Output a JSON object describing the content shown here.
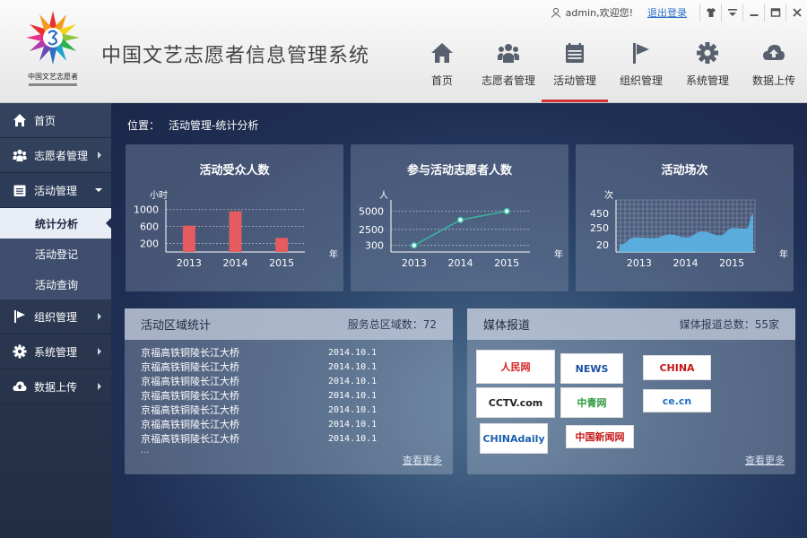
{
  "header": {
    "app_title": "中国文艺志愿者信息管理系统",
    "logo_text": "中国文艺志愿者",
    "user_welcome": "admin,欢迎您!",
    "logout": "退出登录"
  },
  "nav": [
    {
      "label": "首页",
      "icon": "home-icon"
    },
    {
      "label": "志愿者管理",
      "icon": "users-icon"
    },
    {
      "label": "活动管理",
      "icon": "calendar-icon",
      "active": true
    },
    {
      "label": "组织管理",
      "icon": "flag-icon"
    },
    {
      "label": "系统管理",
      "icon": "gear-icon"
    },
    {
      "label": "数据上传",
      "icon": "cloud-upload-icon"
    }
  ],
  "sidebar": {
    "items": [
      {
        "label": "首页"
      },
      {
        "label": "志愿者管理"
      },
      {
        "label": "活动管理"
      },
      {
        "label": "组织管理"
      },
      {
        "label": "系统管理"
      },
      {
        "label": "数据上传"
      }
    ],
    "sub": [
      {
        "label": "统计分析"
      },
      {
        "label": "活动登记"
      },
      {
        "label": "活动查询"
      }
    ]
  },
  "breadcrumb": {
    "prefix": "位置：",
    "path": "活动管理-统计分析"
  },
  "colors": {
    "bar": "#e45c60",
    "line": "#3bb4a0",
    "area": "#5ab4e6"
  },
  "chart_data": [
    {
      "type": "bar",
      "title": "活动受众人数",
      "ylabel": "小时",
      "xlabel": "年",
      "categories": [
        "2013",
        "2014",
        "2015"
      ],
      "values": [
        620,
        960,
        330
      ],
      "yticks": [
        200,
        600,
        1000
      ],
      "ylim": [
        0,
        1100
      ]
    },
    {
      "type": "line",
      "title": "参与活动志愿者人数",
      "ylabel": "人",
      "xlabel": "年",
      "categories": [
        "2013",
        "2014",
        "2015"
      ],
      "values": [
        300,
        3800,
        5000
      ],
      "yticks": [
        300,
        2500,
        5000
      ],
      "ylim": [
        -600,
        5800
      ]
    },
    {
      "type": "area",
      "title": "活动场次",
      "ylabel": "次",
      "xlabel": "年",
      "categories": [
        "2013",
        "2014",
        "2015"
      ],
      "yticks": [
        20,
        250,
        450
      ],
      "ylim": [
        -80,
        560
      ],
      "x": [
        0,
        0.12,
        0.25,
        0.38,
        0.5,
        0.62,
        0.75,
        0.85,
        0.95,
        1.0
      ],
      "values": [
        20,
        120,
        110,
        160,
        120,
        200,
        150,
        250,
        240,
        440
      ]
    }
  ],
  "region_panel": {
    "title": "活动区域统计",
    "count_label": "服务总区域数：72",
    "rows": [
      {
        "name": "京福高铁铜陵长江大桥",
        "date": "2014.10.1"
      },
      {
        "name": "京福高铁铜陵长江大桥",
        "date": "2014.10.1"
      },
      {
        "name": "京福高铁铜陵长江大桥",
        "date": "2014.10.1"
      },
      {
        "name": "京福高铁铜陵长江大桥",
        "date": "2014.10.1"
      },
      {
        "name": "京福高铁铜陵长江大桥",
        "date": "2014.10.1"
      },
      {
        "name": "京福高铁铜陵长江大桥",
        "date": "2014.10.1"
      },
      {
        "name": "京福高铁铜陵长江大桥",
        "date": "2014.10.1"
      }
    ],
    "ellipsis": "...",
    "more": "查看更多"
  },
  "media_panel": {
    "title": "媒体报道",
    "count_label": "媒体报道总数：55家",
    "more": "查看更多",
    "logos": [
      {
        "text": "人民网",
        "color": "#d41e1e"
      },
      {
        "text": "NEWS",
        "color": "#1a4fa0"
      },
      {
        "text": "CHINA",
        "color": "#c41818"
      },
      {
        "text": "CCTV.com",
        "color": "#222222"
      },
      {
        "text": "中青网",
        "color": "#2a9a3a"
      },
      {
        "text": "ce.cn",
        "color": "#1b6fc6"
      },
      {
        "text": "CHINAdaily",
        "color": "#1a5fb0"
      },
      {
        "text": "中国新闻网",
        "color": "#c41818"
      }
    ]
  }
}
